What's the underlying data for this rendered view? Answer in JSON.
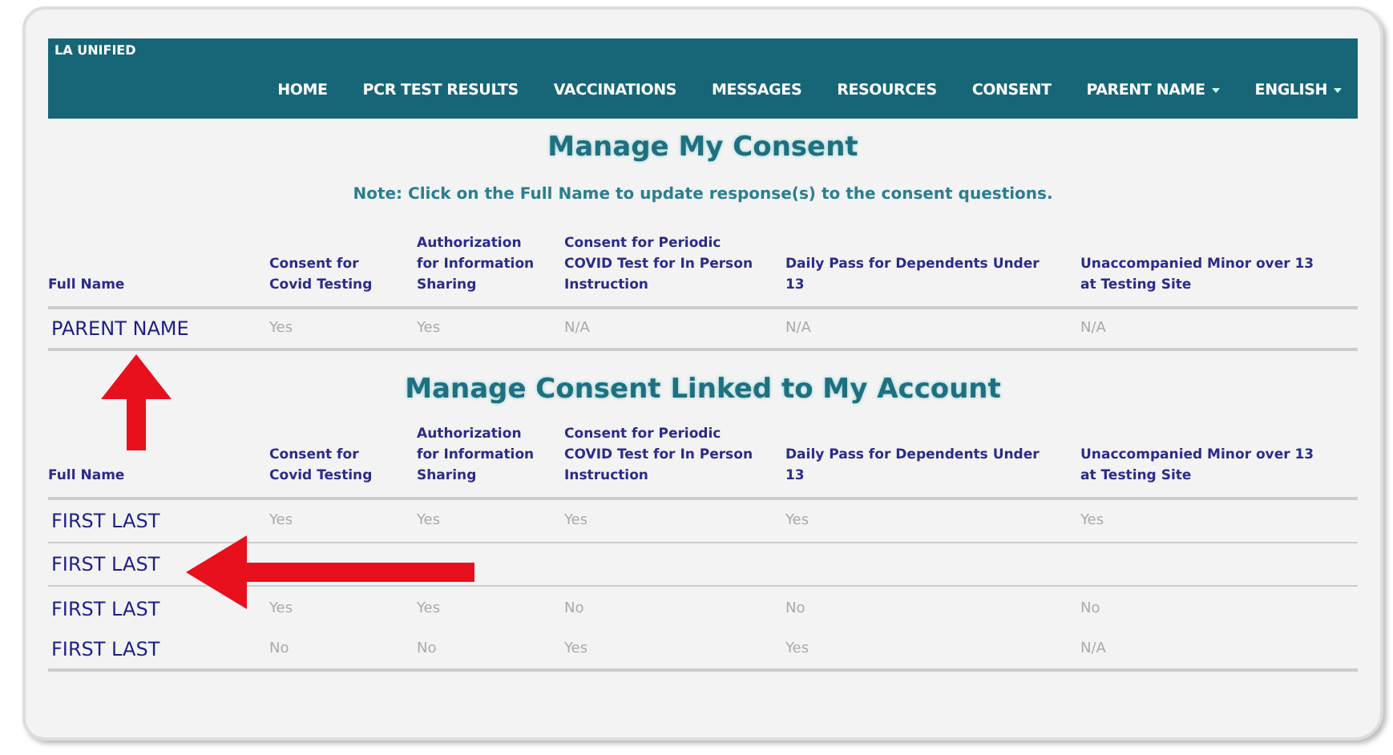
{
  "brand": "LA UNIFIED",
  "nav": [
    {
      "label": "HOME",
      "dropdown": false
    },
    {
      "label": "PCR TEST RESULTS",
      "dropdown": false
    },
    {
      "label": "VACCINATIONS",
      "dropdown": false
    },
    {
      "label": "MESSAGES",
      "dropdown": false
    },
    {
      "label": "RESOURCES",
      "dropdown": false
    },
    {
      "label": "CONSENT",
      "dropdown": false
    },
    {
      "label": "PARENT NAME",
      "dropdown": true
    },
    {
      "label": "ENGLISH",
      "dropdown": true
    }
  ],
  "my_consent": {
    "title": "Manage My Consent",
    "note": "Note: Click on the Full Name to update response(s) to the consent questions.",
    "columns": [
      "Full Name",
      "Consent for Covid Testing",
      "Authorization for Information Sharing",
      "Consent for Periodic COVID Test for In Person Instruction",
      "Daily Pass for Dependents Under 13",
      "Unaccompanied Minor over 13 at Testing Site"
    ],
    "rows": [
      {
        "name": "PARENT NAME",
        "answers": [
          "Yes",
          "Yes",
          "N/A",
          "N/A",
          "N/A"
        ]
      }
    ]
  },
  "linked_consent": {
    "title": "Manage Consent Linked to My Account",
    "columns": [
      "Full Name",
      "Consent for Covid Testing",
      "Authorization for Information Sharing",
      "Consent for Periodic COVID Test for In Person Instruction",
      "Daily Pass for Dependents Under 13",
      "Unaccompanied Minor over 13 at Testing Site"
    ],
    "rows": [
      {
        "name": "FIRST LAST",
        "answers": [
          "Yes",
          "Yes",
          "Yes",
          "Yes",
          "Yes"
        ]
      },
      {
        "name": "FIRST LAST",
        "answers": []
      },
      {
        "name": "FIRST LAST",
        "answers": [
          "Yes",
          "Yes",
          "No",
          "No",
          "No"
        ]
      },
      {
        "name": "FIRST LAST",
        "answers": [
          "No",
          "No",
          "Yes",
          "Yes",
          "N/A"
        ]
      }
    ]
  }
}
